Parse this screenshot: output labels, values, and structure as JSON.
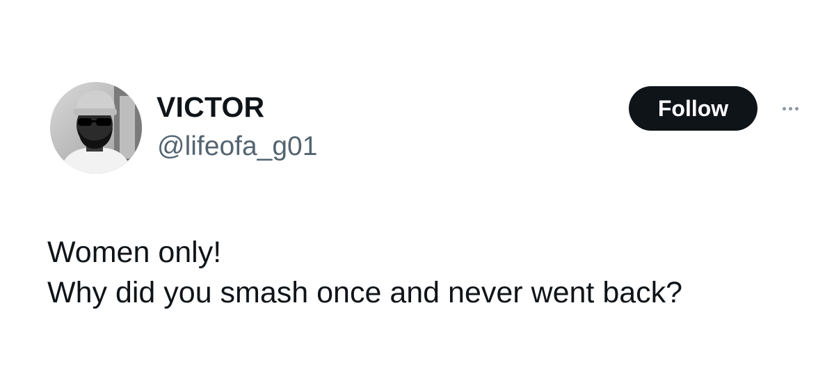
{
  "author": {
    "display_name": "VICTOR",
    "handle": "@lifeofa_g01",
    "avatar_icon": "profile-photo"
  },
  "actions": {
    "follow_label": "Follow",
    "more_icon": "more-horizontal-icon"
  },
  "tweet": {
    "lines": [
      "Women only!",
      "Why did you smash once and never went back?"
    ]
  },
  "colors": {
    "text": "#0f1419",
    "secondary_text": "#536471",
    "button_bg": "#0f1419",
    "button_text": "#ffffff",
    "background": "#ffffff"
  }
}
